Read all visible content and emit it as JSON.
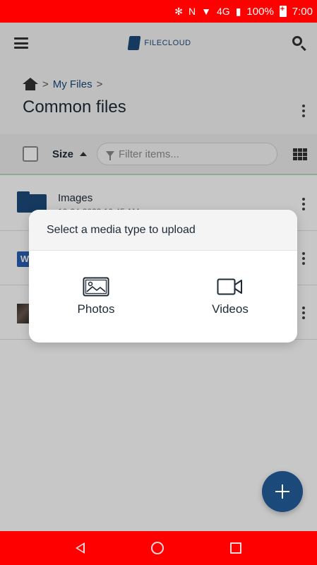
{
  "status_bar": {
    "bluetooth": "✻",
    "nfc": "N",
    "network": "4G",
    "battery_percent": "100%",
    "time": "7:00"
  },
  "app_bar": {
    "logo_text": "FILECLOUD"
  },
  "header": {
    "breadcrumb": [
      "My Files"
    ],
    "separator": ">",
    "title": "Common files"
  },
  "filter_bar": {
    "sort_label": "Size",
    "filter_placeholder": "Filter items..."
  },
  "files": [
    {
      "name": "Images",
      "meta": "10-24-2023 10:45 AM",
      "icon": "folder-icon"
    },
    {
      "name": "",
      "meta": "",
      "icon": "word-doc-icon"
    },
    {
      "name": "",
      "meta": "",
      "icon": "image-thumbnail"
    }
  ],
  "dialog": {
    "title": "Select a media type to upload",
    "options": [
      {
        "label": "Photos",
        "icon": "photo-icon"
      },
      {
        "label": "Videos",
        "icon": "video-camera-icon"
      }
    ]
  },
  "colors": {
    "status_bar": "#ff0000",
    "nav_bar": "#ff0000",
    "brand": "#1b4a7a",
    "accent_line": "#b7d9c2"
  },
  "nav": {
    "back": "back-icon",
    "home": "home-circle-icon",
    "recents": "recents-square-icon"
  }
}
